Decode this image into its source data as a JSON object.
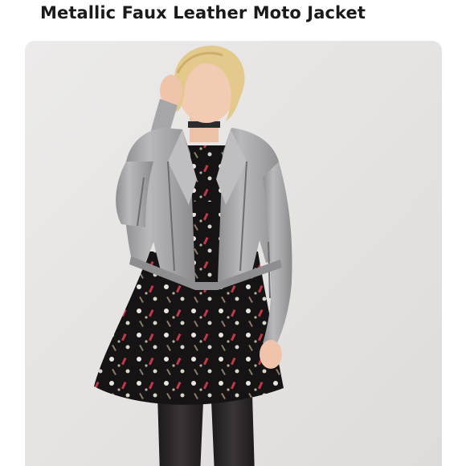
{
  "product": {
    "title": "Metallic Faux Leather Moto Jacket"
  },
  "photo": {
    "icon": "product-photo",
    "colors": {
      "backdrop": "#e7e5e3",
      "jacket": "#a9a9ab",
      "dress": "#151313",
      "hair": "#e3c98c",
      "skin": "#f0c8b0"
    }
  }
}
